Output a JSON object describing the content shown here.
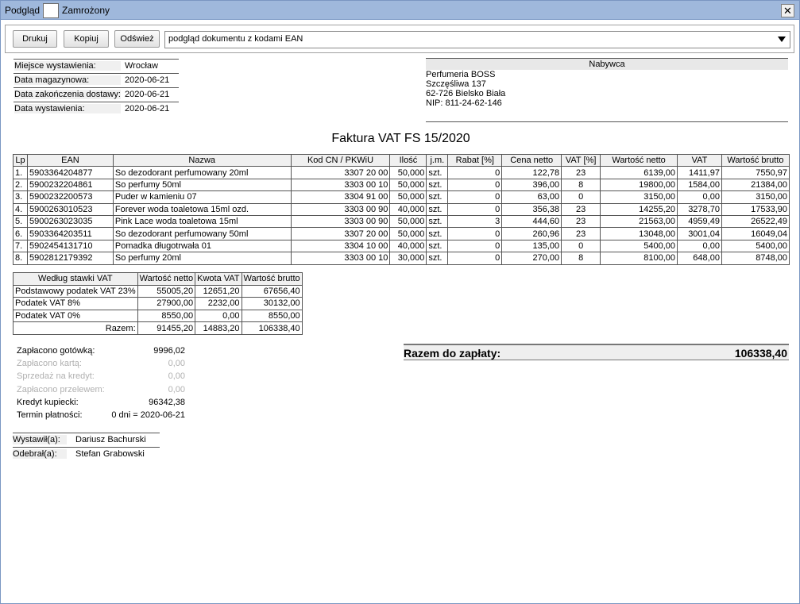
{
  "window": {
    "title": "Podgląd",
    "freeze_label": "Zamrożony",
    "close_glyph": "✕"
  },
  "toolbar": {
    "print_label": "Drukuj",
    "copy_label": "Kopiuj",
    "refresh_label": "Odśwież",
    "mode_selected": "podgląd dokumentu z kodami EAN"
  },
  "meta": [
    {
      "label": "Miejsce wystawienia:",
      "value": "Wrocław"
    },
    {
      "label": "Data magazynowa:",
      "value": "2020-06-21"
    },
    {
      "label": "Data zakończenia dostawy:",
      "value": "2020-06-21"
    },
    {
      "label": "Data wystawienia:",
      "value": "2020-06-21"
    }
  ],
  "buyer": {
    "header": "Nabywca",
    "name": "Perfumeria BOSS",
    "street": "Szczęśliwa 137",
    "city": "62-726 Bielsko Biała",
    "nip": "NIP: 811-24-62-146"
  },
  "document_title": "Faktura VAT FS 15/2020",
  "items_table": {
    "headers": [
      "Lp",
      "EAN",
      "Nazwa",
      "Kod CN / PKWiU",
      "Ilość",
      "j.m.",
      "Rabat [%]",
      "Cena netto",
      "VAT [%]",
      "Wartość netto",
      "VAT",
      "Wartość brutto"
    ],
    "rows": [
      [
        "1.",
        "5903364204877",
        "So dezodorant perfumowany 20ml",
        "3307 20 00",
        "50,000",
        "szt.",
        "0",
        "122,78",
        "23",
        "6139,00",
        "1411,97",
        "7550,97"
      ],
      [
        "2.",
        "5900232204861",
        "So perfumy 50ml",
        "3303 00 10",
        "50,000",
        "szt.",
        "0",
        "396,00",
        "8",
        "19800,00",
        "1584,00",
        "21384,00"
      ],
      [
        "3.",
        "5900232200573",
        "Puder w kamieniu 07",
        "3304 91 00",
        "50,000",
        "szt.",
        "0",
        "63,00",
        "0",
        "3150,00",
        "0,00",
        "3150,00"
      ],
      [
        "4.",
        "5900263010523",
        "Forever woda toaletowa 15ml ozd.",
        "3303 00 90",
        "40,000",
        "szt.",
        "0",
        "356,38",
        "23",
        "14255,20",
        "3278,70",
        "17533,90"
      ],
      [
        "5.",
        "5900263023035",
        "Pink Lace woda toaletowa 15ml",
        "3303 00 90",
        "50,000",
        "szt.",
        "3",
        "444,60",
        "23",
        "21563,00",
        "4959,49",
        "26522,49"
      ],
      [
        "6.",
        "5903364203511",
        "So dezodorant perfumowany 50ml",
        "3307 20 00",
        "50,000",
        "szt.",
        "0",
        "260,96",
        "23",
        "13048,00",
        "3001,04",
        "16049,04"
      ],
      [
        "7.",
        "5902454131710",
        "Pomadka długotrwała 01",
        "3304 10 00",
        "40,000",
        "szt.",
        "0",
        "135,00",
        "0",
        "5400,00",
        "0,00",
        "5400,00"
      ],
      [
        "8.",
        "5902812179392",
        "So perfumy 20ml",
        "3303 00 10",
        "30,000",
        "szt.",
        "0",
        "270,00",
        "8",
        "8100,00",
        "648,00",
        "8748,00"
      ]
    ]
  },
  "vat_table": {
    "headers": [
      "Według stawki VAT",
      "Wartość netto",
      "Kwota VAT",
      "Wartość brutto"
    ],
    "rows": [
      [
        "Podstawowy podatek VAT 23%",
        "55005,20",
        "12651,20",
        "67656,40"
      ],
      [
        "Podatek VAT 8%",
        "27900,00",
        "2232,00",
        "30132,00"
      ],
      [
        "Podatek VAT 0%",
        "8550,00",
        "0,00",
        "8550,00"
      ],
      [
        "Razem:",
        "91455,20",
        "14883,20",
        "106338,40"
      ]
    ]
  },
  "payments": [
    {
      "label": "Zapłacono gotówką:",
      "value": "9996,02",
      "dim": false
    },
    {
      "label": "Zapłacono kartą:",
      "value": "0,00",
      "dim": true
    },
    {
      "label": "Sprzedaż na kredyt:",
      "value": "0,00",
      "dim": true
    },
    {
      "label": "Zapłacono przelewem:",
      "value": "0,00",
      "dim": true
    },
    {
      "label": "Kredyt kupiecki:",
      "value": "96342,38",
      "dim": false
    },
    {
      "label": "Termin płatności:",
      "value": "0 dni = 2020-06-21",
      "dim": false
    }
  ],
  "total": {
    "label": "Razem do zapłaty:",
    "value": "106338,40"
  },
  "signatures": {
    "issued_label": "Wystawił(a):",
    "issued_name": "Dariusz Bachurski",
    "received_label": "Odebrał(a):",
    "received_name": "Stefan Grabowski"
  }
}
